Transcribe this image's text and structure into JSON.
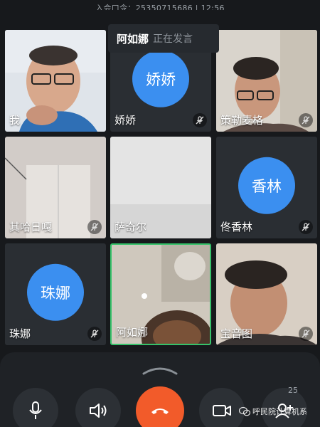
{
  "header": {
    "meeting_info": "入会口令：25350715686 | 12:56"
  },
  "speaker_banner": {
    "name": "阿如娜",
    "status": "正在发言"
  },
  "participants": [
    {
      "name": "我",
      "avatar_text": "",
      "muted": false
    },
    {
      "name": "娇娇",
      "avatar_text": "娇娇",
      "muted": true
    },
    {
      "name": "策勒麦格",
      "avatar_text": "",
      "muted": true
    },
    {
      "name": "其哈日嘎",
      "avatar_text": "",
      "muted": true
    },
    {
      "name": "萨奇尔",
      "avatar_text": "",
      "muted": false
    },
    {
      "name": "佟香林",
      "avatar_text": "香林",
      "muted": true
    },
    {
      "name": "珠娜",
      "avatar_text": "珠娜",
      "muted": true
    },
    {
      "name": "阿如娜",
      "avatar_text": "",
      "muted": false
    },
    {
      "name": "宝音图",
      "avatar_text": "",
      "muted": true
    }
  ],
  "controls": {
    "participant_count": "25"
  },
  "watermark": {
    "text": "呼民院计算机系"
  },
  "colors": {
    "background": "#17191c",
    "tile": "#2a2e33",
    "avatar_blue": "#3b8ff0",
    "active_speaker_border": "#36c26a",
    "hangup": "#f25b2a"
  }
}
